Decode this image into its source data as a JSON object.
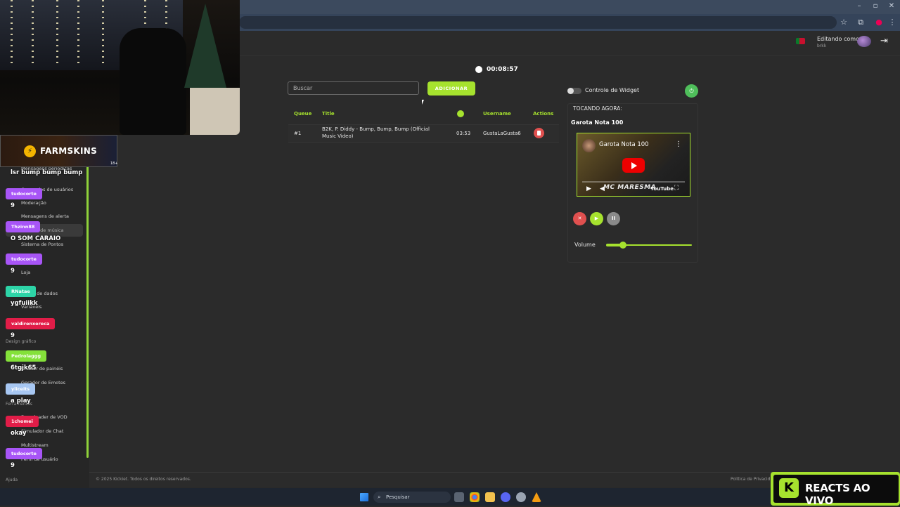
{
  "header": {
    "editing_label": "Editando como",
    "editing_user": "brkk"
  },
  "timer": "00:08:57",
  "search": {
    "placeholder": "Buscar"
  },
  "add_button": "ADICIONAR",
  "queue": {
    "columns": [
      "Queue",
      "Title",
      "Username",
      "Actions"
    ],
    "rows": [
      {
        "position": "#1",
        "title_line1": "B2K, P. Diddy - Bump, Bump, Bump (Official",
        "title_line2": "Music Video)",
        "duration": "03:53",
        "username": "GustaLaGusta6"
      }
    ]
  },
  "widget": {
    "label": "Controle de Widget",
    "enabled": false
  },
  "now_playing": {
    "label": "TOCANDO AGORA:",
    "title": "Garota Nota 100",
    "video_title": "Garota Nota 100",
    "video_overlay": "MC MARESMA",
    "video_brand": "YouTube"
  },
  "controls": {
    "skip": "✕",
    "play": "▶",
    "pause": "II"
  },
  "volume": {
    "label": "Volume",
    "level": 0.2
  },
  "footer": {
    "copyright": "© 2025 Kickiet. Todos os direitos reservados.",
    "privacy": "Política de Privacid"
  },
  "farmskins": {
    "name": "FARMSKINS",
    "age": "18+"
  },
  "sidebar": {
    "items": [
      {
        "label": "Mensagens periódicas"
      },
      {
        "label": "Comandos de usuários"
      },
      {
        "label": "Moderação"
      },
      {
        "label": "Mensagens de alerta"
      },
      {
        "label": "Pedidos de música"
      },
      {
        "label": "Sistema de Pontos"
      },
      {
        "label": "Loja"
      },
      {
        "label": "Banco de dados"
      },
      {
        "label": "Variáveis"
      },
      {
        "label": "Criador de painéis"
      },
      {
        "label": "Gerador de Emotes"
      },
      {
        "label": "Downloader de VOD"
      },
      {
        "label": "Simulador de Chat"
      },
      {
        "label": "Multistream"
      },
      {
        "label": "Perfil de usuário"
      }
    ],
    "sections": {
      "design": "Design gráfico",
      "tools": "Ferramentas",
      "help": "Ajuda"
    }
  },
  "chat": [
    {
      "name": "tudocorte",
      "color": "#a855f7",
      "msg": "9"
    },
    {
      "name": "Thzinn88",
      "color": "#a855f7",
      "msg": "O SOM CARAIO"
    },
    {
      "name": "tudocorte",
      "color": "#a855f7",
      "msg": "9"
    },
    {
      "name": "RNatae",
      "color": "#2dd4a7",
      "msg": "ygfuiikk"
    },
    {
      "name": "valdirenxereca",
      "color": "#e11d48",
      "msg": "9"
    },
    {
      "name": "Pedrolaggg",
      "color": "#84e13a",
      "msg": "6tgjk65"
    },
    {
      "name": "yliceits",
      "color": "#a7c7f2",
      "msg": "a play"
    },
    {
      "name": "1chomei",
      "color": "#e11d48",
      "msg": "okay"
    },
    {
      "name": "tudocorte",
      "color": "#a855f7",
      "msg": "9"
    }
  ],
  "chat_top_msg": "lsr bump bump bump",
  "reacts": {
    "text": "REACTS AO VIVO",
    "logo": "K"
  },
  "taskbar": {
    "search": "Pesquisar"
  },
  "window": {
    "minimize": "–",
    "maximize": "▫",
    "close": "✕"
  }
}
